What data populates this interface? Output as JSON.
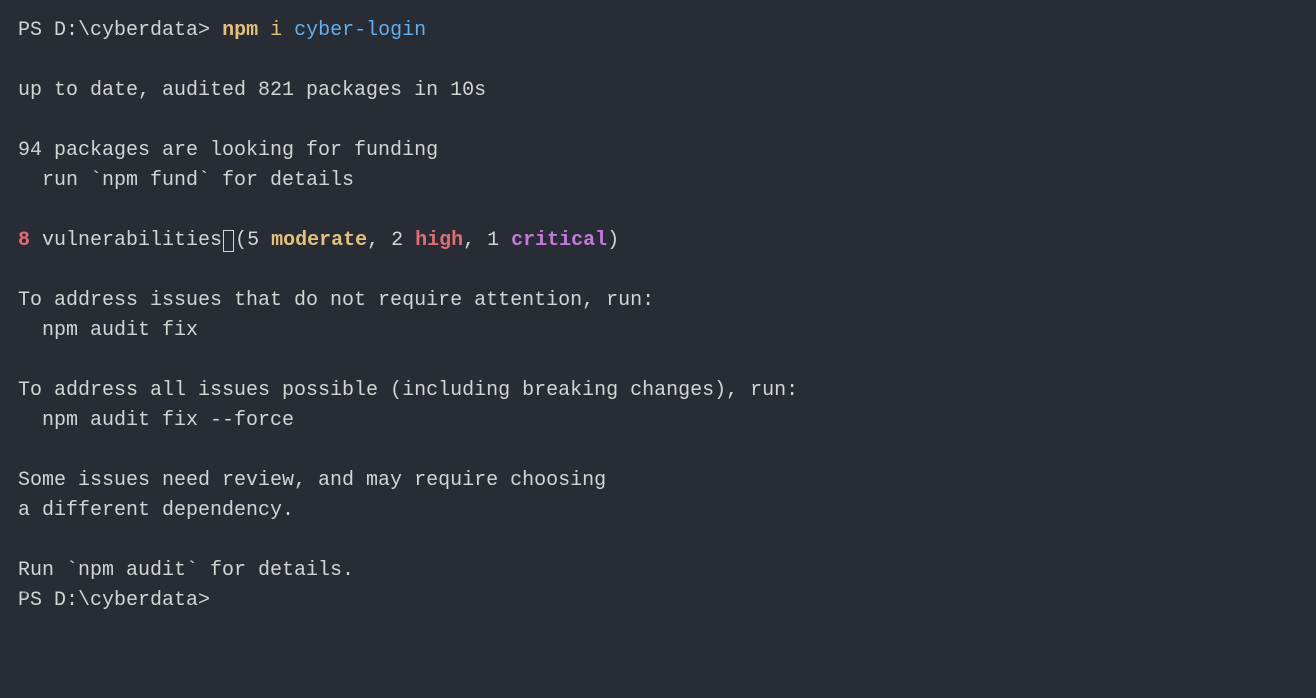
{
  "prompt1": {
    "ps": "PS ",
    "path": "D:\\cyberdata>",
    "space": " ",
    "cmd_keyword": "npm",
    "cmd_sub": " i",
    "cmd_arg": " cyber-login"
  },
  "line_empty": "",
  "audit_line": "up to date, audited 821 packages in 10s",
  "funding1": "94 packages are looking for funding",
  "funding2": "  run `npm fund` for details",
  "vuln": {
    "count": "8",
    "text1": " vulnerabilities",
    "paren_open": "(",
    "mod_count": "5 ",
    "mod_label": "moderate",
    "sep1": ", ",
    "high_count": "2 ",
    "high_label": "high",
    "sep2": ", ",
    "crit_count": "1 ",
    "crit_label": "critical",
    "paren_close": ")"
  },
  "address1": "To address issues that do not require attention, run:",
  "address2": "  npm audit fix",
  "address3": "To address all issues possible (including breaking changes), run:",
  "address4": "  npm audit fix --force",
  "review1": "Some issues need review, and may require choosing",
  "review2": "a different dependency.",
  "audit_details": "Run `npm audit` for details.",
  "prompt2": {
    "ps": "PS ",
    "path": "D:\\cyberdata>",
    "space": " "
  },
  "gutter_marker": "○"
}
